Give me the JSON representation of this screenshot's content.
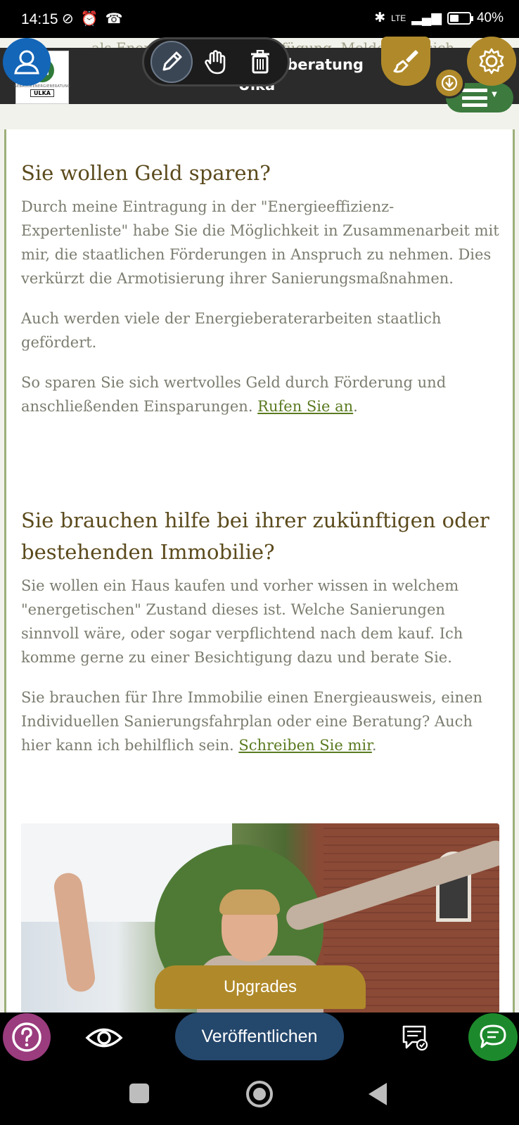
{
  "status_bar": {
    "time": "14:15",
    "network": "LTE",
    "battery": "40%"
  },
  "header": {
    "ghost_text": "als Energieberater zur Verfügung. Melden Sie sich",
    "site_title_line1": "Gebäudeenergieberatung",
    "site_title_line2": "Ulka",
    "logo_small_text": "GEBÄUDEENERGIEBERATUNG",
    "logo_badge": "ULKA"
  },
  "section1": {
    "heading": "Sie wollen Geld sparen?",
    "paragraph1": "Durch meine Eintragung in der \"Energieeffizienz-Expertenliste\" habe Sie die Möglichkeit in Zusammenarbeit mit mir, die staatlichen Förderungen in Anspruch zu nehmen. Dies verkürzt die Armotisierung ihrer Sanierungsmaßnahmen.",
    "paragraph2": "Auch werden viele der Energieberaterarbeiten staatlich gefördert.",
    "paragraph3_text": "So sparen Sie sich wertvolles Geld durch Förderung und anschließenden Einsparungen. ",
    "paragraph3_link": "Rufen Sie an",
    "paragraph3_end": "."
  },
  "section2": {
    "heading": "Sie brauchen hilfe bei ihrer zukünftigen oder bestehenden Immobilie?",
    "paragraph1": "Sie wollen ein Haus kaufen und vorher wissen in welchem \"energetischen\" Zustand dieses ist.  Welche Sanierungen sinnvoll wäre, oder sogar verpflichtend nach dem kauf. Ich komme gerne zu einer Besichtigung dazu und berate Sie.",
    "paragraph2_text": "Sie brauchen für Ihre Immobilie einen Energieausweis, einen Individuellen Sanierungsfahrplan oder eine Beratung? Auch hier kann ich behilflich sein. ",
    "paragraph2_link": "Schreiben Sie mir",
    "paragraph2_end": "."
  },
  "editor": {
    "upgrades_label": "Upgrades",
    "publish_label": "Veröffentlichen"
  },
  "icons": {
    "user": "user-icon",
    "pencil": "pencil-icon",
    "hand": "hand-icon",
    "trash": "trash-icon",
    "brush": "paintbrush-icon",
    "download": "download-icon",
    "settings": "gear-icon",
    "menu": "hamburger-icon",
    "help": "help-icon",
    "preview": "eye-icon",
    "review": "review-icon",
    "chat": "chat-icon"
  },
  "colors": {
    "accent_gold": "#b08a2a",
    "brand_green": "#3c7a3e",
    "publish_blue": "#24476c",
    "heading_brown": "#5b4a1c",
    "link_green": "#5a7a20"
  }
}
